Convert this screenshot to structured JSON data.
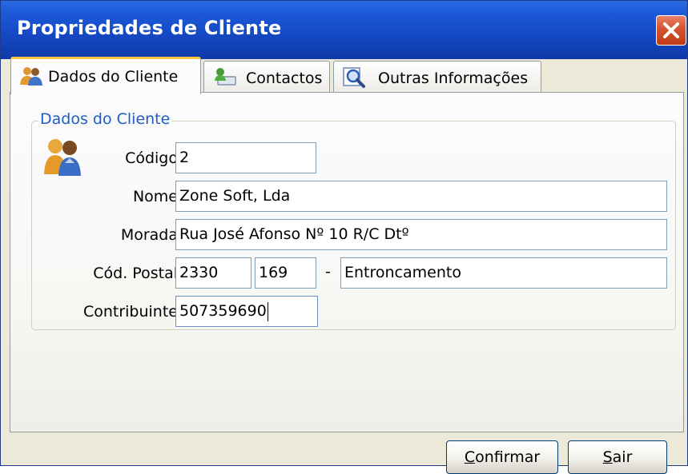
{
  "window": {
    "title": "Propriedades de Cliente",
    "close_icon": "close-icon"
  },
  "tabs": [
    {
      "label": "Dados do Cliente",
      "icon": "users-icon",
      "active": true
    },
    {
      "label": "Contactos",
      "icon": "contacts-card-icon",
      "active": false
    },
    {
      "label": "Outras Informações",
      "icon": "magnifier-icon",
      "active": false
    }
  ],
  "group": {
    "legend": "Dados do Cliente",
    "icon": "users-icon"
  },
  "form": {
    "codigo": {
      "label": "Código",
      "value": "2"
    },
    "nome": {
      "label": "Nome",
      "value": "Zone Soft, Lda"
    },
    "morada": {
      "label": "Morada",
      "value": "Rua José Afonso Nº 10 R/C Dtº"
    },
    "cod_postal": {
      "label": "Cód. Postal",
      "part1": "2330",
      "part2": "169",
      "separator": "-",
      "localidade": "Entroncamento"
    },
    "contribuinte": {
      "label": "Contribuinte",
      "value": "507359690"
    }
  },
  "buttons": {
    "confirmar": {
      "first": "C",
      "rest": "onfirmar"
    },
    "sair": {
      "first": "S",
      "rest": "air"
    }
  },
  "colors": {
    "titlebar": "#1447c2",
    "legend_text": "#1f5cc8",
    "active_tab_accent": "#ffc83c",
    "close_button": "#d4532f"
  }
}
